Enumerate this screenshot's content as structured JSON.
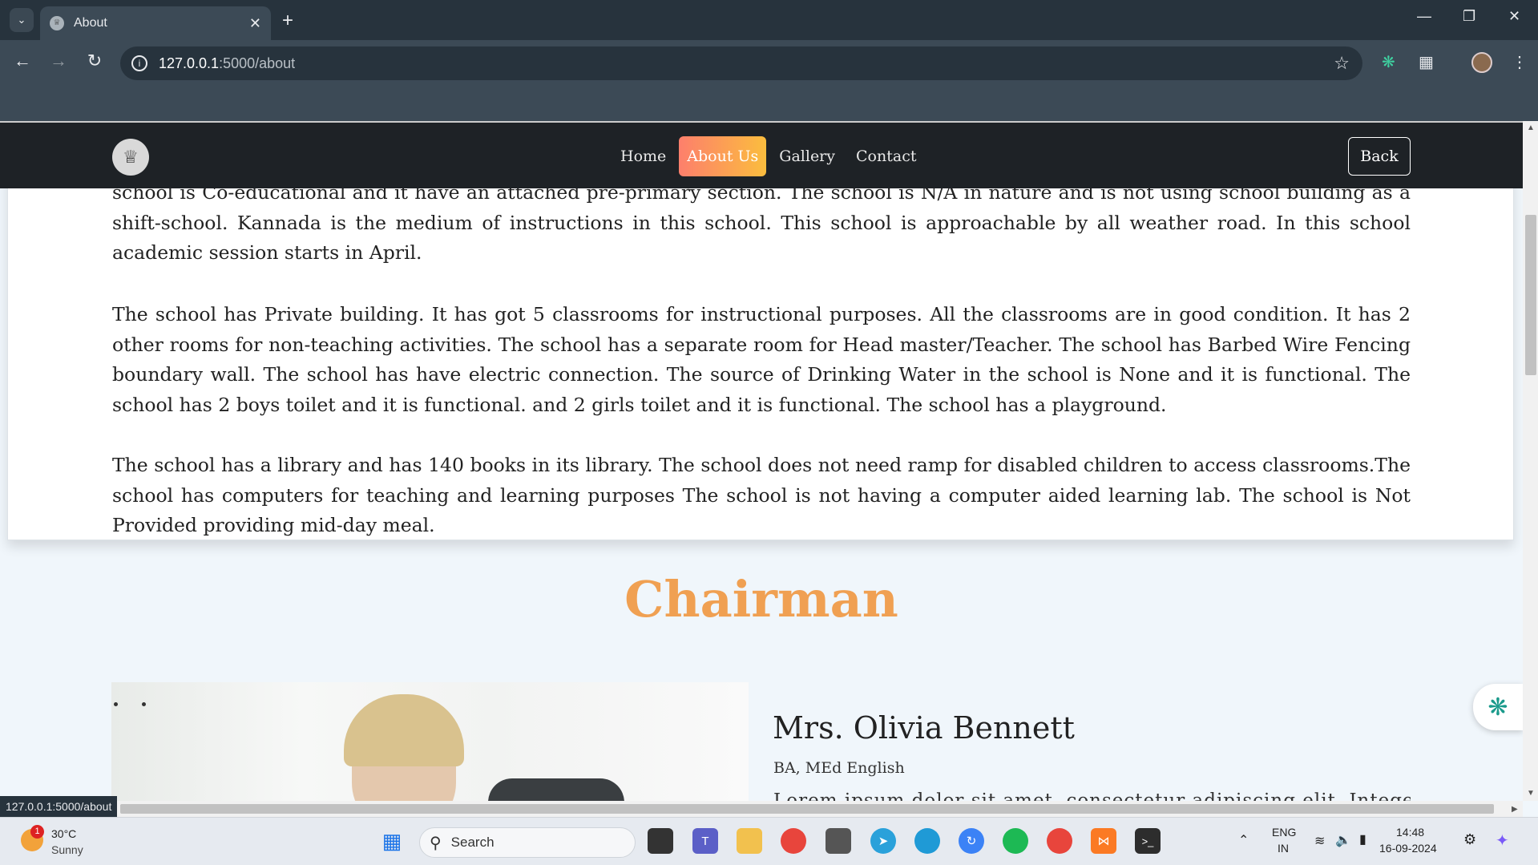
{
  "browser": {
    "tab_title": "About",
    "address_host": "127.0.0.1",
    "address_path": ":5000/about",
    "status_url": "127.0.0.1:5000/about"
  },
  "site": {
    "nav": [
      "Home",
      "About Us",
      "Gallery",
      "Contact"
    ],
    "active_nav": "About Us",
    "back_label": "Back"
  },
  "about": {
    "paragraphs": [
      "school is Co-educational and it have an attached pre-primary section. The school is N/A in nature and is not using school building as a shift-school. Kannada is the medium of instructions in this school. This school is approachable by all weather road. In this school academic session starts in April.",
      "The school has Private building. It has got 5 classrooms for instructional purposes. All the classrooms are in good condition. It has 2 other rooms for non-teaching activities. The school has a separate room for Head master/Teacher. The school has Barbed Wire Fencing boundary wall. The school has have electric connection. The source of Drinking Water in the school is None and it is functional. The school has 2 boys toilet and it is functional. and 2 girls toilet and it is functional. The school has a playground.",
      "The school has a library and has 140 books in its library. The school does not need ramp for disabled children to access classrooms.The school has computers for teaching and learning purposes The school is not having a computer aided learning lab. The school is Not Provided providing mid-day meal."
    ]
  },
  "chairman": {
    "section_title": "Chairman",
    "name": "Mrs. Olivia Bennett",
    "qualification": "BA, MEd English",
    "bio_start": "Lorem ipsum dolor sit amet, consectetur adipiscing elit. Integer"
  },
  "taskbar": {
    "weather_badge": "1",
    "temperature": "30°C",
    "condition": "Sunny",
    "search_label": "Search",
    "lang_top": "ENG",
    "lang_bottom": "IN",
    "time": "14:48",
    "date": "16-09-2024"
  },
  "colors": {
    "accent_orange": "#f0a052",
    "nav_bg": "#1e2226",
    "chrome_bg": "#3c4a56"
  }
}
